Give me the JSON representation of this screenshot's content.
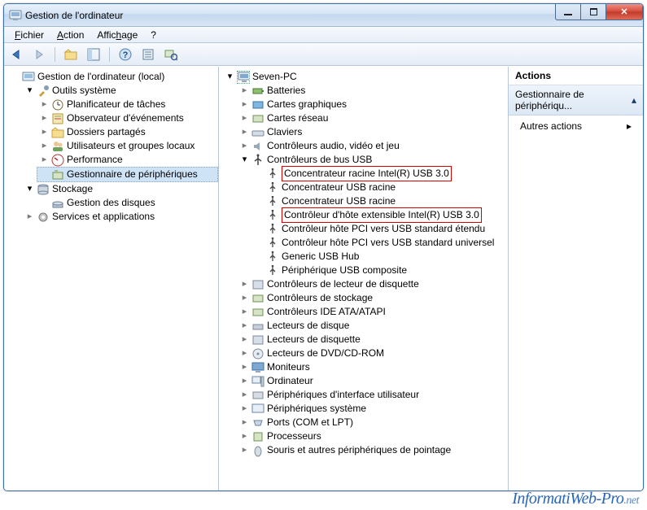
{
  "window": {
    "title": "Gestion de l'ordinateur"
  },
  "menu": {
    "fichier": "Fichier",
    "action": "Action",
    "affichage": "Affichage",
    "help": "?"
  },
  "left_tree": {
    "root": "Gestion de l'ordinateur (local)",
    "systools": "Outils système",
    "scheduler": "Planificateur de tâches",
    "eventvwr": "Observateur d'événements",
    "shared": "Dossiers partagés",
    "users": "Utilisateurs et groupes locaux",
    "perf": "Performance",
    "devmgr": "Gestionnaire de périphériques",
    "storage": "Stockage",
    "diskmgr": "Gestion des disques",
    "services": "Services et applications"
  },
  "dev_tree": {
    "root": "Seven-PC",
    "batteries": "Batteries",
    "gfx": "Cartes graphiques",
    "netcards": "Cartes réseau",
    "keyboards": "Claviers",
    "audio": "Contrôleurs audio, vidéo et jeu",
    "usb": "Contrôleurs de bus USB",
    "usb0": "Concentrateur racine Intel(R) USB 3.0",
    "usb1": "Concentrateur USB racine",
    "usb2": "Concentrateur USB racine",
    "usb3": "Contrôleur d'hôte extensible Intel(R) USB 3.0",
    "usb4": "Contrôleur hôte PCI vers USB standard étendu",
    "usb5": "Contrôleur hôte PCI vers USB standard universel",
    "usb6": "Generic USB Hub",
    "usb7": "Périphérique USB composite",
    "floppyc": "Contrôleurs de lecteur de disquette",
    "storagec": "Contrôleurs de stockage",
    "ide": "Contrôleurs IDE ATA/ATAPI",
    "diskd": "Lecteurs de disque",
    "floppyd": "Lecteurs de disquette",
    "dvd": "Lecteurs de DVD/CD-ROM",
    "monitors": "Moniteurs",
    "computer": "Ordinateur",
    "hid": "Périphériques d'interface utilisateur",
    "sysdev": "Périphériques système",
    "ports": "Ports (COM et LPT)",
    "cpu": "Processeurs",
    "mouse": "Souris et autres périphériques de pointage"
  },
  "actions": {
    "header": "Actions",
    "sub": "Gestionnaire de périphériqu...",
    "other": "Autres actions"
  },
  "watermark": {
    "a": "InformatiWeb-Pro",
    "b": ".net"
  }
}
